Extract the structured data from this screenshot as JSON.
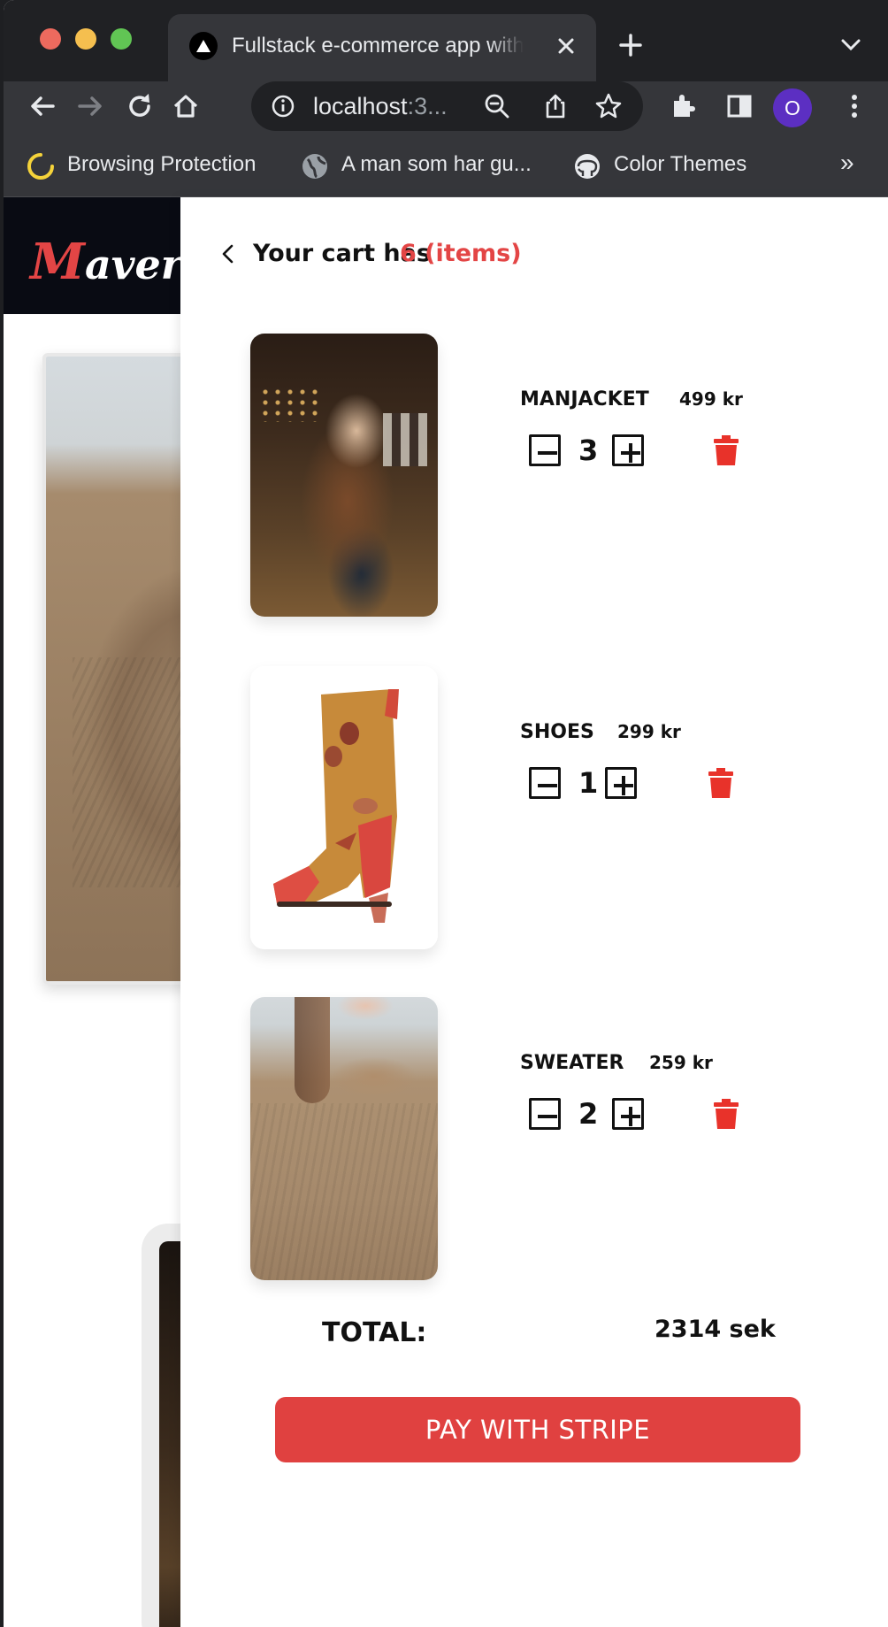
{
  "browser": {
    "tab_title": "Fullstack e-commerce app with",
    "url_host": "localhost",
    "url_rest": ":3...",
    "profile_initial": "O",
    "bookmarks": [
      {
        "label": "Browsing Protection",
        "icon": "browsing-protection-icon"
      },
      {
        "label": "A man som har gu...",
        "icon": "globe-icon"
      },
      {
        "label": "Color Themes",
        "icon": "github-icon"
      }
    ],
    "bookmarks_more": "»"
  },
  "site": {
    "logo_first": "M",
    "logo_rest": "averi"
  },
  "cart": {
    "title": "Your cart has",
    "count_text": "6 (items)",
    "items": [
      {
        "name": "MANJACKET",
        "price": "499 kr",
        "qty": "3"
      },
      {
        "name": "SHOES",
        "price": "299 kr",
        "qty": "1"
      },
      {
        "name": "SWEATER",
        "price": "259 kr",
        "qty": "2"
      }
    ],
    "total_label": "TOTAL:",
    "total_value": "2314 sek",
    "pay_label": "PAY WITH STRIPE"
  },
  "colors": {
    "accent": "#e34545",
    "pay_button": "#e04140",
    "trash": "#e8322a",
    "header_bg": "#090b13",
    "profile": "#5c2fc2"
  }
}
